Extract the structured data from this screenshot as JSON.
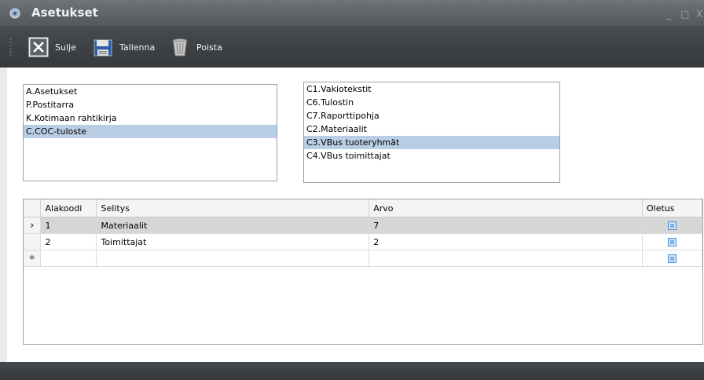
{
  "window": {
    "title": "Asetukset",
    "controls": {
      "minimize": "_",
      "maximize": "□",
      "close": "X"
    }
  },
  "toolbar": {
    "close": {
      "label": "Sulje",
      "icon": "close-x-icon"
    },
    "save": {
      "label": "Tallenna",
      "icon": "floppy-disk-icon"
    },
    "delete": {
      "label": "Poista",
      "icon": "trash-can-icon"
    }
  },
  "left_list": {
    "items": [
      "A.Asetukset",
      "P.Postitarra",
      "K.Kotimaan rahtikirja",
      "C.COC-tuloste"
    ],
    "selected_index": 3
  },
  "right_list": {
    "items": [
      "C1.Vakiotekstit",
      "C6.Tulostin",
      "C7.Raporttipohja",
      "C2.Materiaalit",
      "C3.VBus tuoteryhmät",
      "C4.VBus toimittajat"
    ],
    "selected_index": 4
  },
  "grid": {
    "columns": [
      "Alakoodi",
      "Selitys",
      "Arvo",
      "Oletus"
    ],
    "rows": [
      {
        "indicator": "›",
        "alakoodi": "1",
        "selitys": "Materiaalit",
        "arvo": "7"
      },
      {
        "indicator": "",
        "alakoodi": "2",
        "selitys": "Toimittajat",
        "arvo": "2"
      }
    ],
    "new_row": {
      "indicator": "✱"
    }
  },
  "colors": {
    "titlebar": "#5d6266",
    "toolbar": "#3d4145",
    "selection": "#b9cde5",
    "current_row": "#d6d6d6"
  }
}
